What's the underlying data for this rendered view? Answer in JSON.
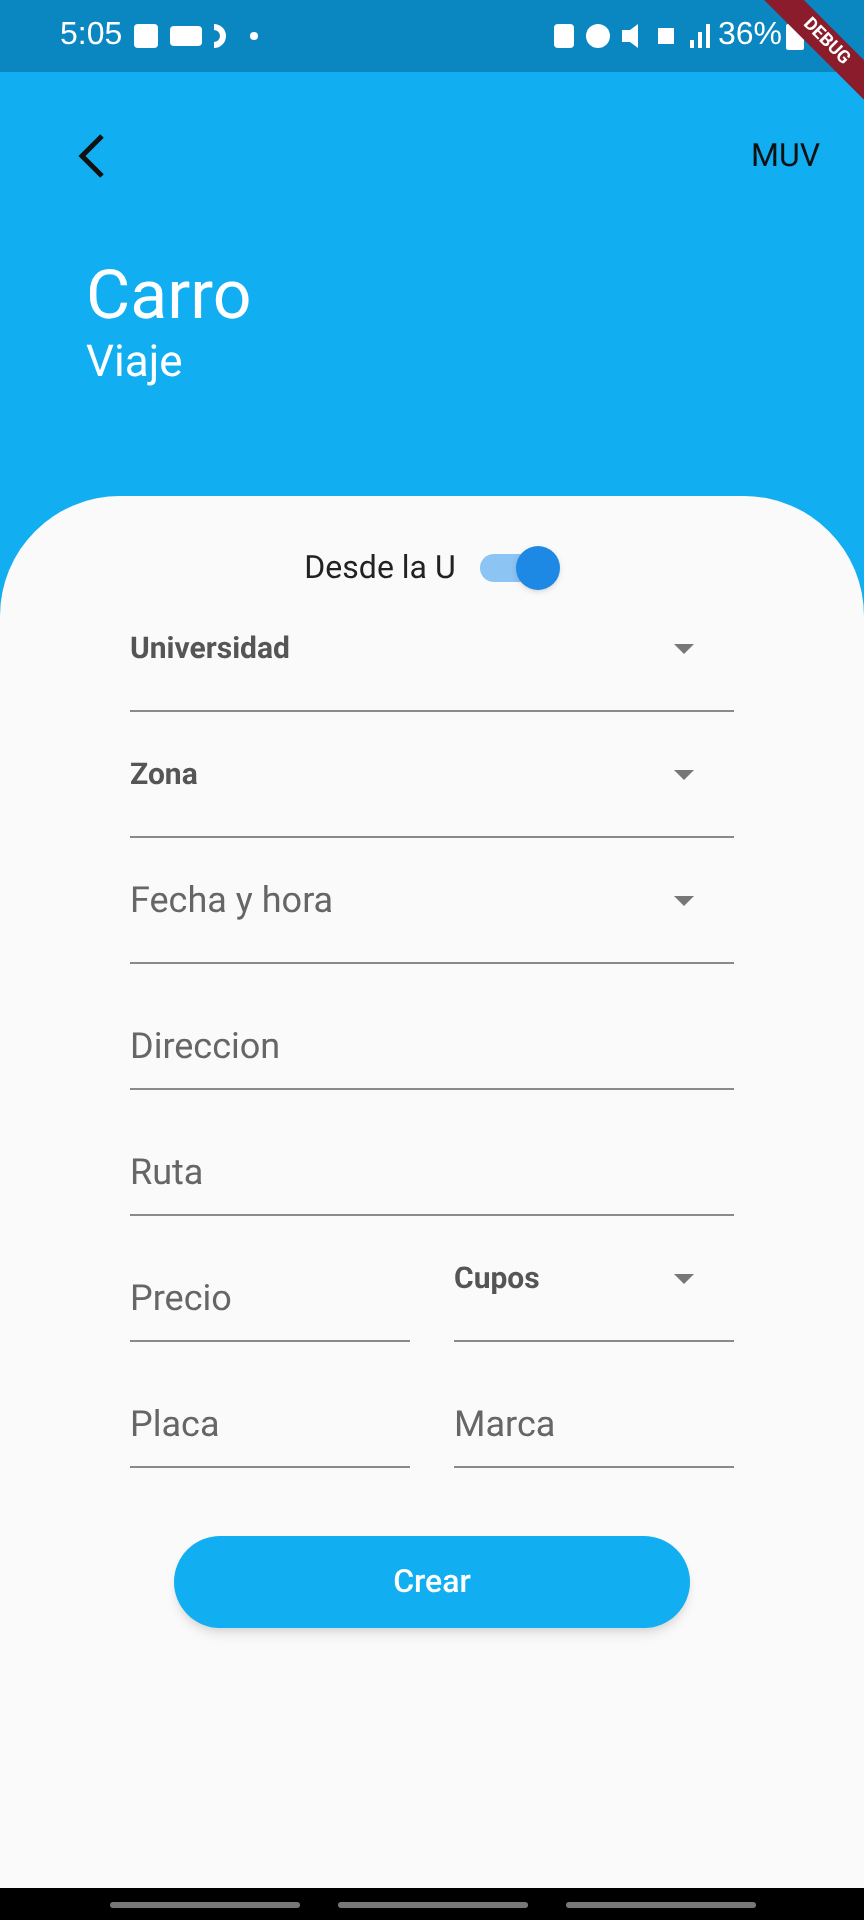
{
  "status_bar": {
    "time": "5:05",
    "battery": "36%"
  },
  "debug_banner": "DEBUG",
  "header": {
    "action": "MUV",
    "title": "Carro",
    "subtitle": "Viaje"
  },
  "toggle": {
    "label": "Desde la U",
    "on": true
  },
  "field_rows": [
    [
      {
        "kind": "select",
        "label": "Universidad"
      }
    ],
    [
      {
        "kind": "select",
        "label": "Zona"
      }
    ],
    [
      {
        "kind": "picker",
        "label": "Fecha y hora"
      }
    ],
    [
      {
        "kind": "text",
        "placeholder": "Direccion"
      }
    ],
    [
      {
        "kind": "text",
        "placeholder": "Ruta"
      }
    ],
    [
      {
        "kind": "text",
        "placeholder": "Precio"
      },
      {
        "kind": "select",
        "label": "Cupos"
      }
    ],
    [
      {
        "kind": "text",
        "placeholder": "Placa"
      },
      {
        "kind": "text",
        "placeholder": "Marca"
      }
    ]
  ],
  "submit": "Crear"
}
